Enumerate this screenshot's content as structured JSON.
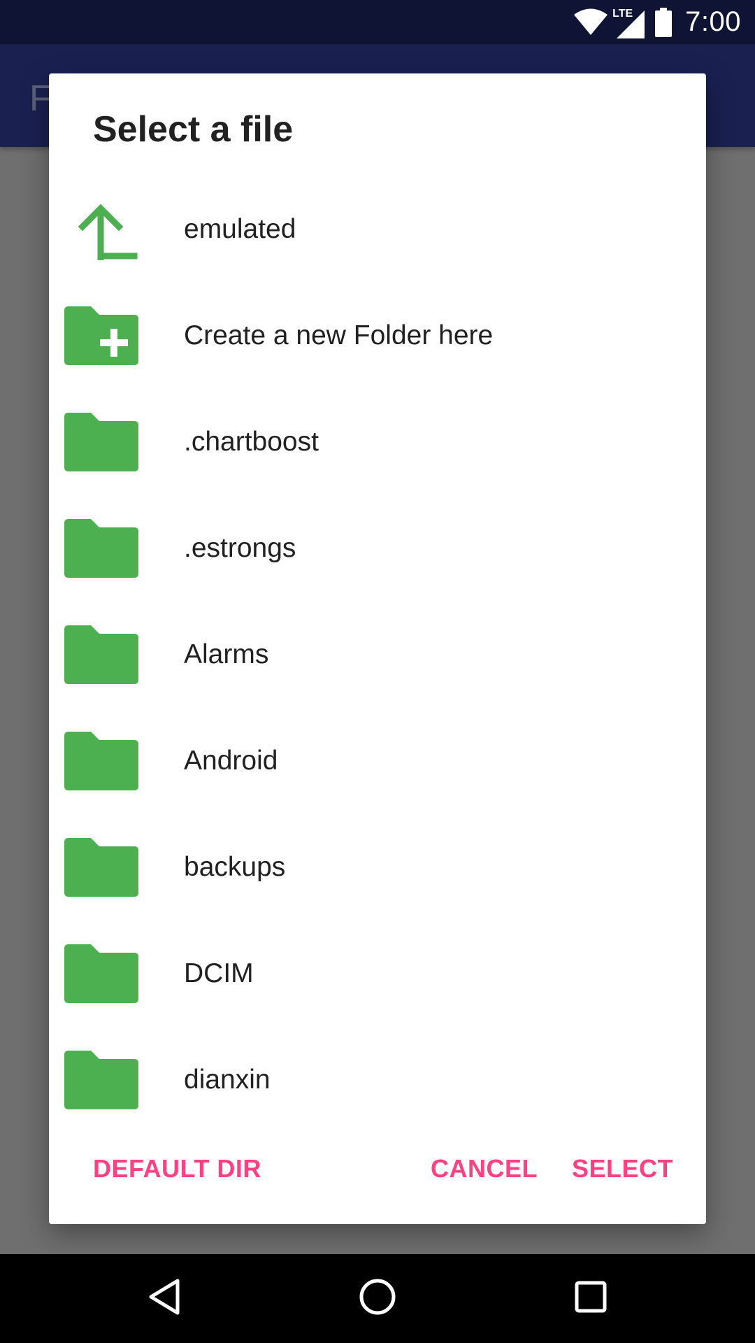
{
  "status_bar": {
    "time": "7:00",
    "network_label": "LTE",
    "icons": [
      "wifi-icon",
      "cell-signal-icon",
      "battery-icon"
    ]
  },
  "app_bar": {
    "title_fragment": "F"
  },
  "dialog": {
    "title": "Select a file",
    "items": [
      {
        "icon": "folder-up-icon",
        "label": "emulated"
      },
      {
        "icon": "create-folder-icon",
        "label": "Create a new Folder here"
      },
      {
        "icon": "folder-icon",
        "label": ".chartboost"
      },
      {
        "icon": "folder-icon",
        "label": ".estrongs"
      },
      {
        "icon": "folder-icon",
        "label": "Alarms"
      },
      {
        "icon": "folder-icon",
        "label": "Android"
      },
      {
        "icon": "folder-icon",
        "label": "backups"
      },
      {
        "icon": "folder-icon",
        "label": "DCIM"
      },
      {
        "icon": "folder-icon",
        "label": "dianxin"
      }
    ],
    "buttons": {
      "default_dir": "DEFAULT DIR",
      "cancel": "CANCEL",
      "select": "SELECT"
    }
  },
  "nav_bar": {
    "icons": [
      "back-icon",
      "home-icon",
      "recents-icon"
    ]
  },
  "colors": {
    "accent": "#ff4081",
    "folder_green": "#4caf50",
    "status_bar": "#0f1434",
    "app_bar": "#1a2050",
    "scrim": "#6f6f6f"
  }
}
